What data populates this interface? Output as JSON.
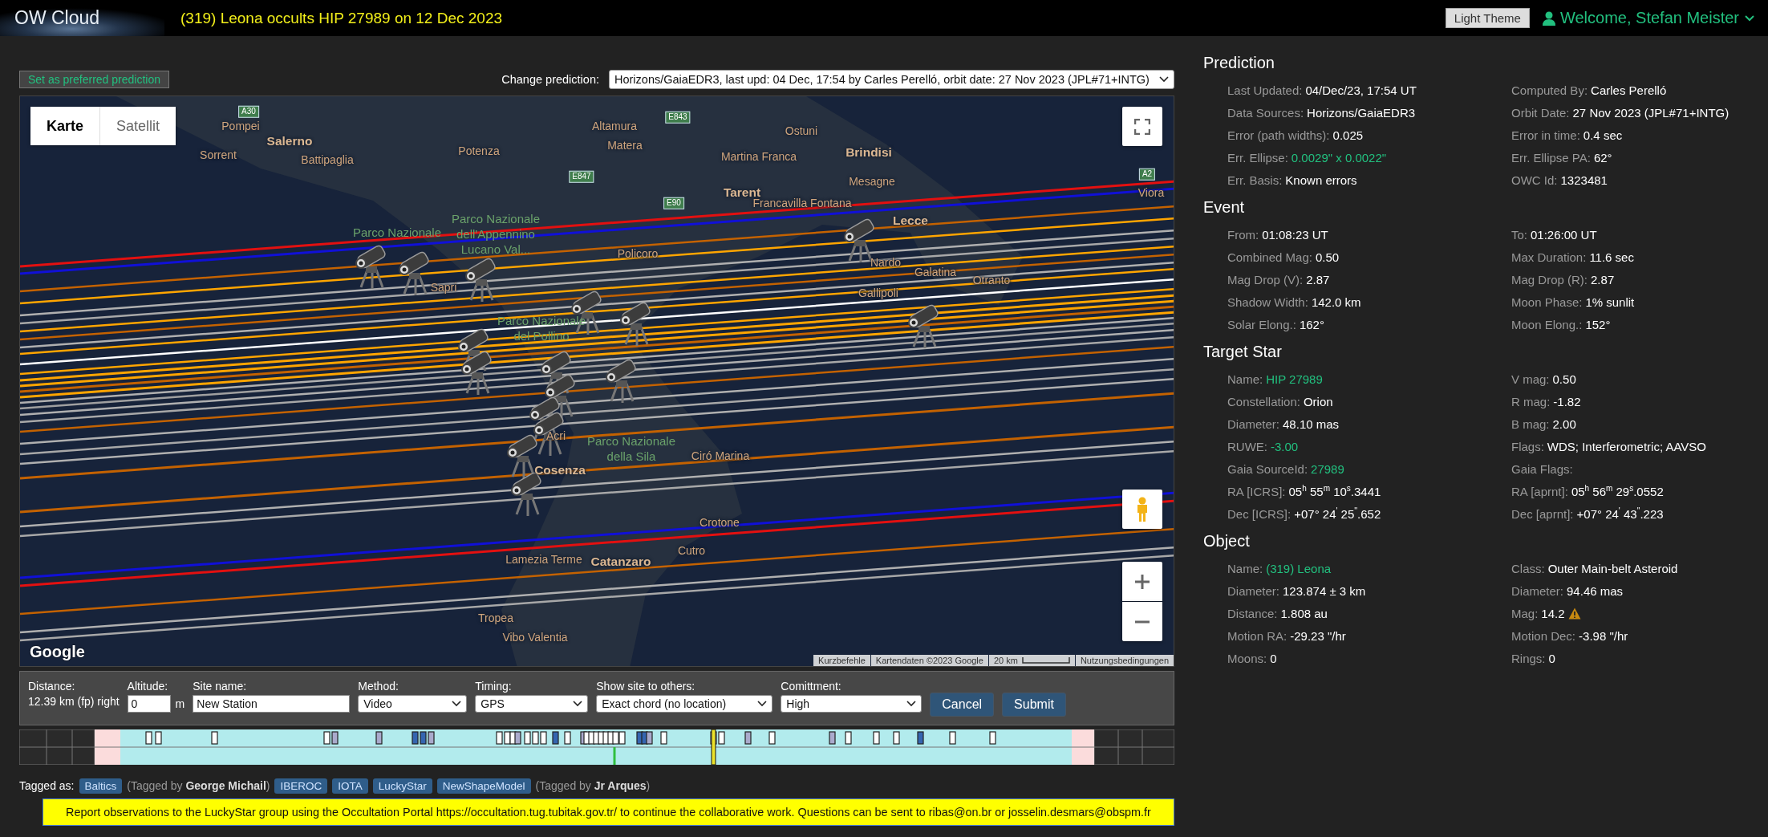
{
  "header": {
    "logo": "OW Cloud",
    "title": "(319) Leona occults HIP 27989 on 12 Dec 2023",
    "theme_button": "Light Theme",
    "user": "Welcome, Stefan Meister"
  },
  "toolbar": {
    "preferred_button": "Set as preferred prediction",
    "change_label": "Change prediction:",
    "prediction": "Horizons/GaiaEDR3, last upd: 04 Dec, 17:54 by Carles Perelló, orbit date: 27 Nov 2023 (JPL#71+INTG)"
  },
  "map": {
    "map_types": [
      {
        "label": "Karte",
        "selected": true
      },
      {
        "label": "Satellit",
        "selected": false
      }
    ],
    "places": [
      {
        "kind": "town",
        "text": "Pompei"
      },
      {
        "kind": "town",
        "text": "Sorrent"
      },
      {
        "kind": "city",
        "text": "Salerno"
      },
      {
        "kind": "town",
        "text": "Battipaglia"
      },
      {
        "kind": "town",
        "text": "Potenza"
      },
      {
        "kind": "town",
        "text": "Altamura"
      },
      {
        "kind": "town",
        "text": "Matera"
      },
      {
        "kind": "town",
        "text": "Ostuni"
      },
      {
        "kind": "town",
        "text": "Martina Franca"
      },
      {
        "kind": "city",
        "text": "Brindisi"
      },
      {
        "kind": "town",
        "text": "Mesagne"
      },
      {
        "kind": "city",
        "text": "Tarent"
      },
      {
        "kind": "town",
        "text": "Francavilla Fontana"
      },
      {
        "kind": "park",
        "text": "Parco Nazionale"
      },
      {
        "kind": "park",
        "text": "Parco Nazionale dell'Appennino Lucano Val..."
      },
      {
        "kind": "town",
        "text": "Policoro"
      },
      {
        "kind": "city",
        "text": "Lecce"
      },
      {
        "kind": "town",
        "text": "Nardo"
      },
      {
        "kind": "town",
        "text": "Galatina"
      },
      {
        "kind": "town",
        "text": "Otranto"
      },
      {
        "kind": "town",
        "text": "Gallipoli"
      },
      {
        "kind": "town",
        "text": "Sapri"
      },
      {
        "kind": "park",
        "text": "Parco Nazionale del Pollino"
      },
      {
        "kind": "town",
        "text": "Acri"
      },
      {
        "kind": "park",
        "text": "Parco Nazionale della Sila"
      },
      {
        "kind": "town",
        "text": "Ciró Marina"
      },
      {
        "kind": "city",
        "text": "Cosenza"
      },
      {
        "kind": "town",
        "text": "Crotone"
      },
      {
        "kind": "town",
        "text": "Cutro"
      },
      {
        "kind": "town",
        "text": "Lamezia Terme"
      },
      {
        "kind": "city",
        "text": "Catanzaro"
      },
      {
        "kind": "town",
        "text": "Tropea"
      },
      {
        "kind": "town",
        "text": "Vibo Valentia"
      },
      {
        "kind": "town",
        "text": "Viora"
      },
      {
        "kind": "road",
        "text": "A30"
      },
      {
        "kind": "road",
        "text": "E843"
      },
      {
        "kind": "road",
        "text": "E847"
      },
      {
        "kind": "road",
        "text": "E90"
      },
      {
        "kind": "road",
        "text": "A2"
      }
    ],
    "logo": "Google",
    "attribution": [
      "Kurzbefehle",
      "Kartendaten ©2023 Google",
      "20 km",
      "Nutzungsbedingungen"
    ]
  },
  "form": {
    "distance_label": "Distance:",
    "distance": "12.39 km (fp) right",
    "altitude_label": "Altitude:",
    "altitude": "0",
    "altitude_unit": "m",
    "site_label": "Site name:",
    "site_name": "New Station",
    "method_label": "Method:",
    "method": "Video",
    "timing_label": "Timing:",
    "timing": "GPS",
    "show_label": "Show site to others:",
    "show": "Exact chord (no location)",
    "commitment_label": "Comittment:",
    "commitment": "High",
    "buttons": [
      "Cancel",
      "Submit"
    ]
  },
  "tags": {
    "label": "Tagged as:",
    "items": [
      {
        "kind": "tag",
        "text": "Baltics"
      },
      {
        "kind": "note",
        "text": "(Tagged by **George Michail**)"
      },
      {
        "kind": "tag",
        "text": "IBEROC"
      },
      {
        "kind": "tag",
        "text": "IOTA"
      },
      {
        "kind": "tag",
        "text": "LuckyStar"
      },
      {
        "kind": "tag",
        "text": "NewShapeModel"
      },
      {
        "kind": "note",
        "text": "(Tagged by **Jr Arques**)"
      }
    ]
  },
  "notice": "Report observations to the LuckyStar group using the Occultation Portal https://occultation.tug.tubitak.gov.tr/ to continue the collaborative work. Questions can be sent to ribas@on.br or josselin.desmars@obspm.fr",
  "sections": [
    {
      "title": "Prediction",
      "items": [
        {
          "label": "Last Updated:",
          "value": "04/Dec/23, 17:54 UT"
        },
        {
          "label": "Computed By:",
          "value": "Carles Perelló"
        },
        {
          "label": "Data Sources:",
          "value": "Horizons/GaiaEDR3"
        },
        {
          "label": "Orbit Date:",
          "value": "27 Nov 2023 (JPL#71+INTG)"
        },
        {
          "label": "Error (path widths):",
          "value": "0.025"
        },
        {
          "label": "Error in time:",
          "value": "0.4 sec"
        },
        {
          "label": "Err. Ellipse:",
          "value": "0.0029\" x 0.0022\"",
          "link": true
        },
        {
          "label": "Err. Ellipse PA:",
          "value": "62°"
        },
        {
          "label": "Err. Basis:",
          "value": "Known errors"
        },
        {
          "label": "OWC Id:",
          "value": "1323481"
        }
      ]
    },
    {
      "title": "Event",
      "items": [
        {
          "label": "From:",
          "value": "01:08:23 UT"
        },
        {
          "label": "To:",
          "value": "01:26:00 UT"
        },
        {
          "label": "Combined Mag:",
          "value": "0.50"
        },
        {
          "label": "Max Duration:",
          "value": "11.6 sec"
        },
        {
          "label": "Mag Drop (V):",
          "value": "2.87"
        },
        {
          "label": "Mag Drop (R):",
          "value": "2.87"
        },
        {
          "label": "Shadow Width:",
          "value": "142.0 km"
        },
        {
          "label": "Moon Phase:",
          "value": "1% sunlit"
        },
        {
          "label": "Solar Elong.:",
          "value": "162°"
        },
        {
          "label": "Moon Elong.:",
          "value": "152°"
        }
      ]
    },
    {
      "title": "Target Star",
      "items": [
        {
          "label": "Name:",
          "value": "HIP 27989",
          "link": true
        },
        {
          "label": "V mag:",
          "value": "0.50"
        },
        {
          "label": "Constellation:",
          "value": "Orion"
        },
        {
          "label": "R mag:",
          "value": "-1.82"
        },
        {
          "label": "Diameter:",
          "value": "48.10 mas"
        },
        {
          "label": "B mag:",
          "value": "2.00"
        },
        {
          "label": "RUWE:",
          "value": "-3.00",
          "link": true
        },
        {
          "label": "Flags:",
          "value": "WDS; Interferometric; AAVSO"
        },
        {
          "label": "Gaia SourceId:",
          "value": "27989",
          "link": true
        },
        {
          "label": "Gaia Flags:"
        },
        {
          "label": "RA [ICRS]:",
          "value": "05$^{h}$ 55$^{m}$ 10$^{s}$.3441"
        },
        {
          "label": "RA [aprnt]:",
          "value": "05$^{h}$ 56$^{m}$ 29$^{s}$.0552"
        },
        {
          "label": "Dec [ICRS]:",
          "value": "+07° 24$^{'}$ 25$^{''}$.652"
        },
        {
          "label": "Dec [aprnt]:",
          "value": "+07° 24$^{'}$ 43$^{''}$.223"
        }
      ]
    },
    {
      "title": "Object",
      "items": [
        {
          "label": "Name:",
          "value": "(319) Leona",
          "link": true
        },
        {
          "label": "Class:",
          "value": "Outer Main-belt Asteroid"
        },
        {
          "label": "Diameter:",
          "value": "123.874 ± 3 km"
        },
        {
          "label": "Diameter:",
          "value": "94.46 mas"
        },
        {
          "label": "Distance:",
          "value": "1.808 au"
        },
        {
          "label": "Mag:",
          "value": "14.2",
          "warning": true
        },
        {
          "label": "Motion RA:",
          "value": "-29.23 \"/hr"
        },
        {
          "label": "Motion Dec:",
          "value": "-3.98 \"/hr"
        },
        {
          "label": "Moons:",
          "value": "0"
        },
        {
          "label": "Rings:",
          "value": "0"
        }
      ]
    }
  ]
}
